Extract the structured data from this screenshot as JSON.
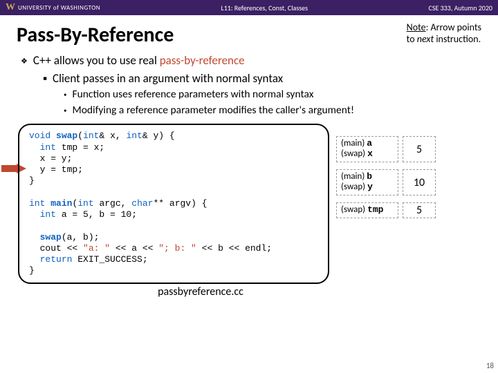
{
  "header": {
    "uni": "UNIVERSITY of WASHINGTON",
    "center": "L11: References, Const, Classes",
    "right": "CSE 333, Autumn 2020"
  },
  "title": "Pass-By-Reference",
  "note": {
    "l1a": "Note",
    "l1b": ": Arrow points",
    "l2a": "to ",
    "l2b": "next",
    "l2c": " instruction."
  },
  "b1a": "C++ allows you to use real ",
  "b1b": "pass-by-reference",
  "b2": "Client passes in an argument with normal syntax",
  "b3": "Function uses reference parameters with normal syntax",
  "b4": "Modifying a reference parameter modifies the caller's argument!",
  "code": {
    "t1a": "void",
    "t1b": " ",
    "t1c": "swap",
    "t1d": "(",
    "t1e": "int",
    "t1f": "& x, ",
    "t1g": "int",
    "t1h": "& y) {",
    "t2a": "  ",
    "t2b": "int",
    "t2c": " tmp = x;",
    "t3": "  x = y;",
    "t4": "  y = tmp;",
    "t5": "}",
    "t6": "",
    "t7a": "int",
    "t7b": " ",
    "t7c": "main",
    "t7d": "(",
    "t7e": "int",
    "t7f": " argc, ",
    "t7g": "char",
    "t7h": "** argv) {",
    "t8a": "  ",
    "t8b": "int",
    "t8c": " a = 5, b = 10;",
    "t9": "",
    "t10a": "  ",
    "t10b": "swap",
    "t10c": "(a, b);",
    "t11a": "  cout << ",
    "t11b": "\"a: \"",
    "t11c": " << a << ",
    "t11d": "\"; b: \"",
    "t11e": " << b << endl;",
    "t12a": "  ",
    "t12b": "return",
    "t12c": " EXIT_SUCCESS;",
    "t13": "}"
  },
  "vars": {
    "r1l1": "(main) ",
    "r1l1m": "a",
    "r1l2": "(swap) ",
    "r1l2m": "x",
    "r1v": "5",
    "r2l1": "(main) ",
    "r2l1m": "b",
    "r2l2": "(swap) ",
    "r2l2m": "y",
    "r2v": "10",
    "r3l": "(swap) ",
    "r3lm": "tmp",
    "r3v": "5"
  },
  "caption": "passbyreference.cc",
  "pagenum": "18"
}
